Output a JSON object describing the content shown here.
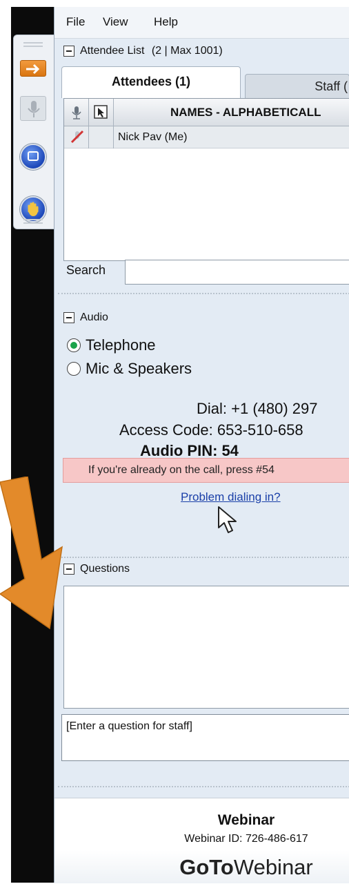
{
  "menu": {
    "file": "File",
    "view": "View",
    "help": "Help"
  },
  "attendee_list": {
    "title": "Attendee List",
    "count": "(2 | Max 1001)",
    "tabs": [
      "Attendees (1)",
      "Staff ("
    ],
    "column_header": "NAMES - ALPHABETICALL",
    "rows": [
      {
        "name": "Nick Pav (Me)"
      }
    ],
    "search_label": "Search",
    "search_value": ""
  },
  "audio": {
    "title": "Audio",
    "options": [
      "Telephone",
      "Mic & Speakers"
    ],
    "selected": "Telephone",
    "dial_label": "Dial:",
    "dial_value": "+1 (480) 297",
    "access_label": "Access Code:",
    "access_value": "653-510-658",
    "pin_label": "Audio PIN:",
    "pin_value": "54",
    "notice": "If you're already on the call, press #54",
    "problem_link": "Problem dialing in?"
  },
  "questions": {
    "title": "Questions",
    "placeholder": "[Enter a question for staff]"
  },
  "footer": {
    "title": "Webinar",
    "id_label": "Webinar ID:",
    "id_value": "726-486-617",
    "brand_bold": "GoTo",
    "brand_light": "Webinar"
  },
  "colors": {
    "accent_orange": "#e38a2a",
    "link_blue": "#1a3fa8",
    "notice_bg": "#f7c7c7",
    "radio_green": "#1aa34a"
  }
}
